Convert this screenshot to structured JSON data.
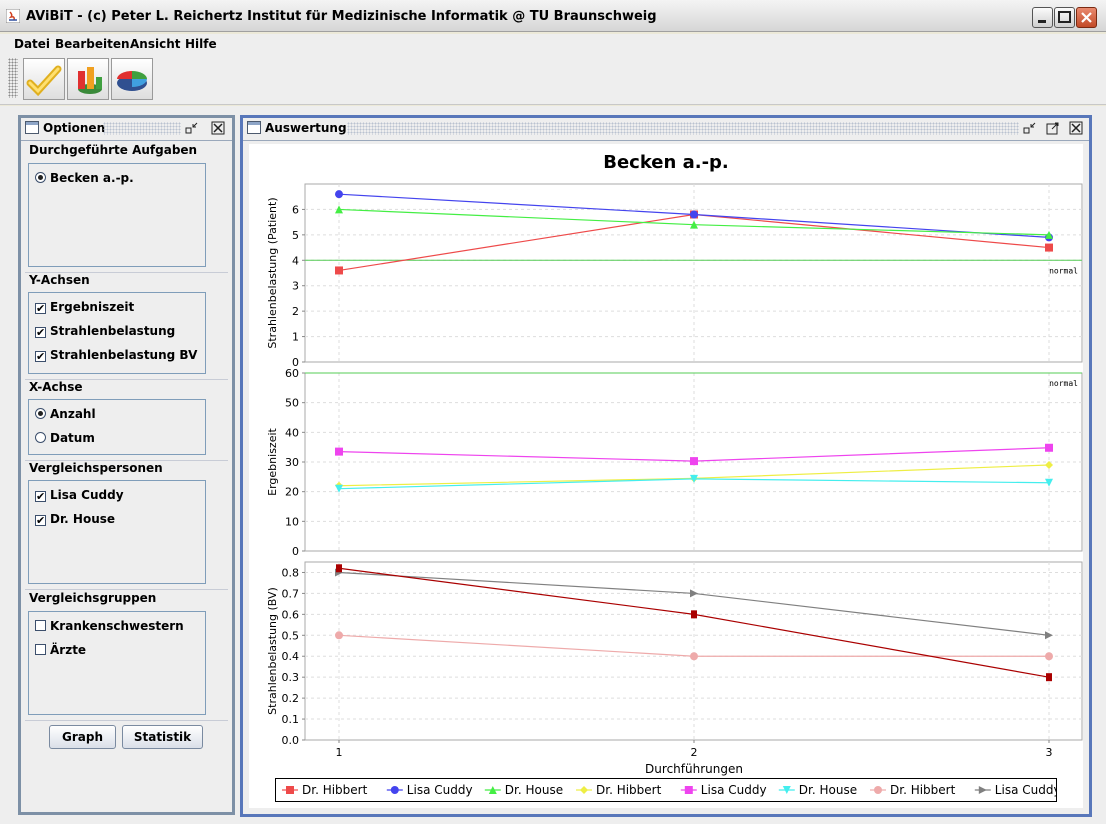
{
  "window": {
    "title": "AViBiT - (c) Peter L. Reichertz Institut für Medizinische Informatik @ TU Braunschweig"
  },
  "menu": [
    "Datei",
    "Bearbeiten",
    "Ansicht",
    "Hilfe"
  ],
  "toolbar": {
    "buttons": [
      {
        "icon": "checkmark-icon"
      },
      {
        "icon": "bar-chart-icon"
      },
      {
        "icon": "pie-chart-icon"
      }
    ]
  },
  "options_panel": {
    "title": "Optionen",
    "sections": {
      "tasks": {
        "label": "Durchgeführte Aufgaben",
        "items": [
          {
            "label": "Becken a.-p.",
            "checked": true
          }
        ]
      },
      "y_axes": {
        "label": "Y-Achsen",
        "items": [
          {
            "label": "Ergebniszeit",
            "checked": true
          },
          {
            "label": "Strahlenbelastung",
            "checked": true
          },
          {
            "label": "Strahlenbelastung BV",
            "checked": true
          }
        ]
      },
      "x_axis": {
        "label": "X-Achse",
        "items": [
          {
            "label": "Anzahl",
            "checked": true
          },
          {
            "label": "Datum",
            "checked": false
          }
        ]
      },
      "persons": {
        "label": "Vergleichspersonen",
        "items": [
          {
            "label": "Lisa Cuddy",
            "checked": true
          },
          {
            "label": "Dr. House",
            "checked": true
          }
        ]
      },
      "groups": {
        "label": "Vergleichsgruppen",
        "items": [
          {
            "label": "Krankenschwestern",
            "checked": false
          },
          {
            "label": "Ärzte",
            "checked": false
          }
        ]
      }
    },
    "buttons": {
      "graph": "Graph",
      "statistik": "Statistik"
    }
  },
  "evaluation_panel": {
    "title": "Auswertung"
  },
  "colors": {
    "red": "#ee4a4a",
    "blue": "#4444ee",
    "green": "#44ee44",
    "yellow": "#eeee44",
    "magenta": "#ee44ee",
    "cyan": "#44eeee",
    "pink": "#eeaaaa",
    "gray": "#808080",
    "darkred": "#aa0000",
    "normal_line": "#55cc55"
  },
  "chart_data": {
    "type": "line",
    "title": "Becken a.-p.",
    "xlabel": "Durchführungen",
    "x": [
      1,
      2,
      3
    ],
    "x_ticks": [
      "1",
      "2",
      "3"
    ],
    "grid": true,
    "legend_position": "bottom",
    "subplots": [
      {
        "ylabel": "Strahlenbelastung (Patient)",
        "ylim": [
          0,
          7
        ],
        "y_ticks": [
          "0",
          "1",
          "2",
          "3",
          "4",
          "5",
          "6"
        ],
        "normal_line": {
          "y": 4,
          "label": "normal"
        },
        "series": [
          {
            "name": "Dr. Hibbert",
            "color": "#ee4a4a",
            "marker": "square",
            "values": [
              3.6,
              5.8,
              4.5
            ]
          },
          {
            "name": "Lisa Cuddy",
            "color": "#4444ee",
            "marker": "circle",
            "values": [
              6.6,
              5.8,
              4.9
            ]
          },
          {
            "name": "Dr. House",
            "color": "#44ee44",
            "marker": "triangle-up",
            "values": [
              6.0,
              5.4,
              5.0
            ]
          }
        ]
      },
      {
        "ylabel": "Ergebniszeit",
        "ylim": [
          0,
          60
        ],
        "y_ticks": [
          "0",
          "10",
          "20",
          "30",
          "40",
          "50",
          "60"
        ],
        "normal_line": {
          "y": 60,
          "label": "normal"
        },
        "series": [
          {
            "name": "Dr. Hibbert",
            "color": "#eeee44",
            "marker": "diamond",
            "values": [
              22,
              24.5,
              29
            ]
          },
          {
            "name": "Lisa Cuddy",
            "color": "#ee44ee",
            "marker": "square",
            "values": [
              33.5,
              30.3,
              34.8
            ]
          },
          {
            "name": "Dr. House",
            "color": "#44eeee",
            "marker": "triangle-down",
            "values": [
              21,
              24.3,
              23
            ]
          }
        ]
      },
      {
        "ylabel": "Strahlenbelastung (BV)",
        "ylim": [
          0,
          0.85
        ],
        "y_ticks": [
          "0.0",
          "0.1",
          "0.2",
          "0.3",
          "0.4",
          "0.5",
          "0.6",
          "0.7",
          "0.8"
        ],
        "series": [
          {
            "name": "Dr. Hibbert",
            "color": "#eeaaaa",
            "marker": "circle",
            "values": [
              0.5,
              0.4,
              0.4
            ]
          },
          {
            "name": "Lisa Cuddy",
            "color": "#808080",
            "marker": "triangle-right",
            "values": [
              0.8,
              0.7,
              0.5
            ]
          },
          {
            "name": "Dr. House",
            "color": "#aa0000",
            "marker": "rect",
            "values": [
              0.82,
              0.6,
              0.3
            ]
          }
        ]
      }
    ]
  }
}
